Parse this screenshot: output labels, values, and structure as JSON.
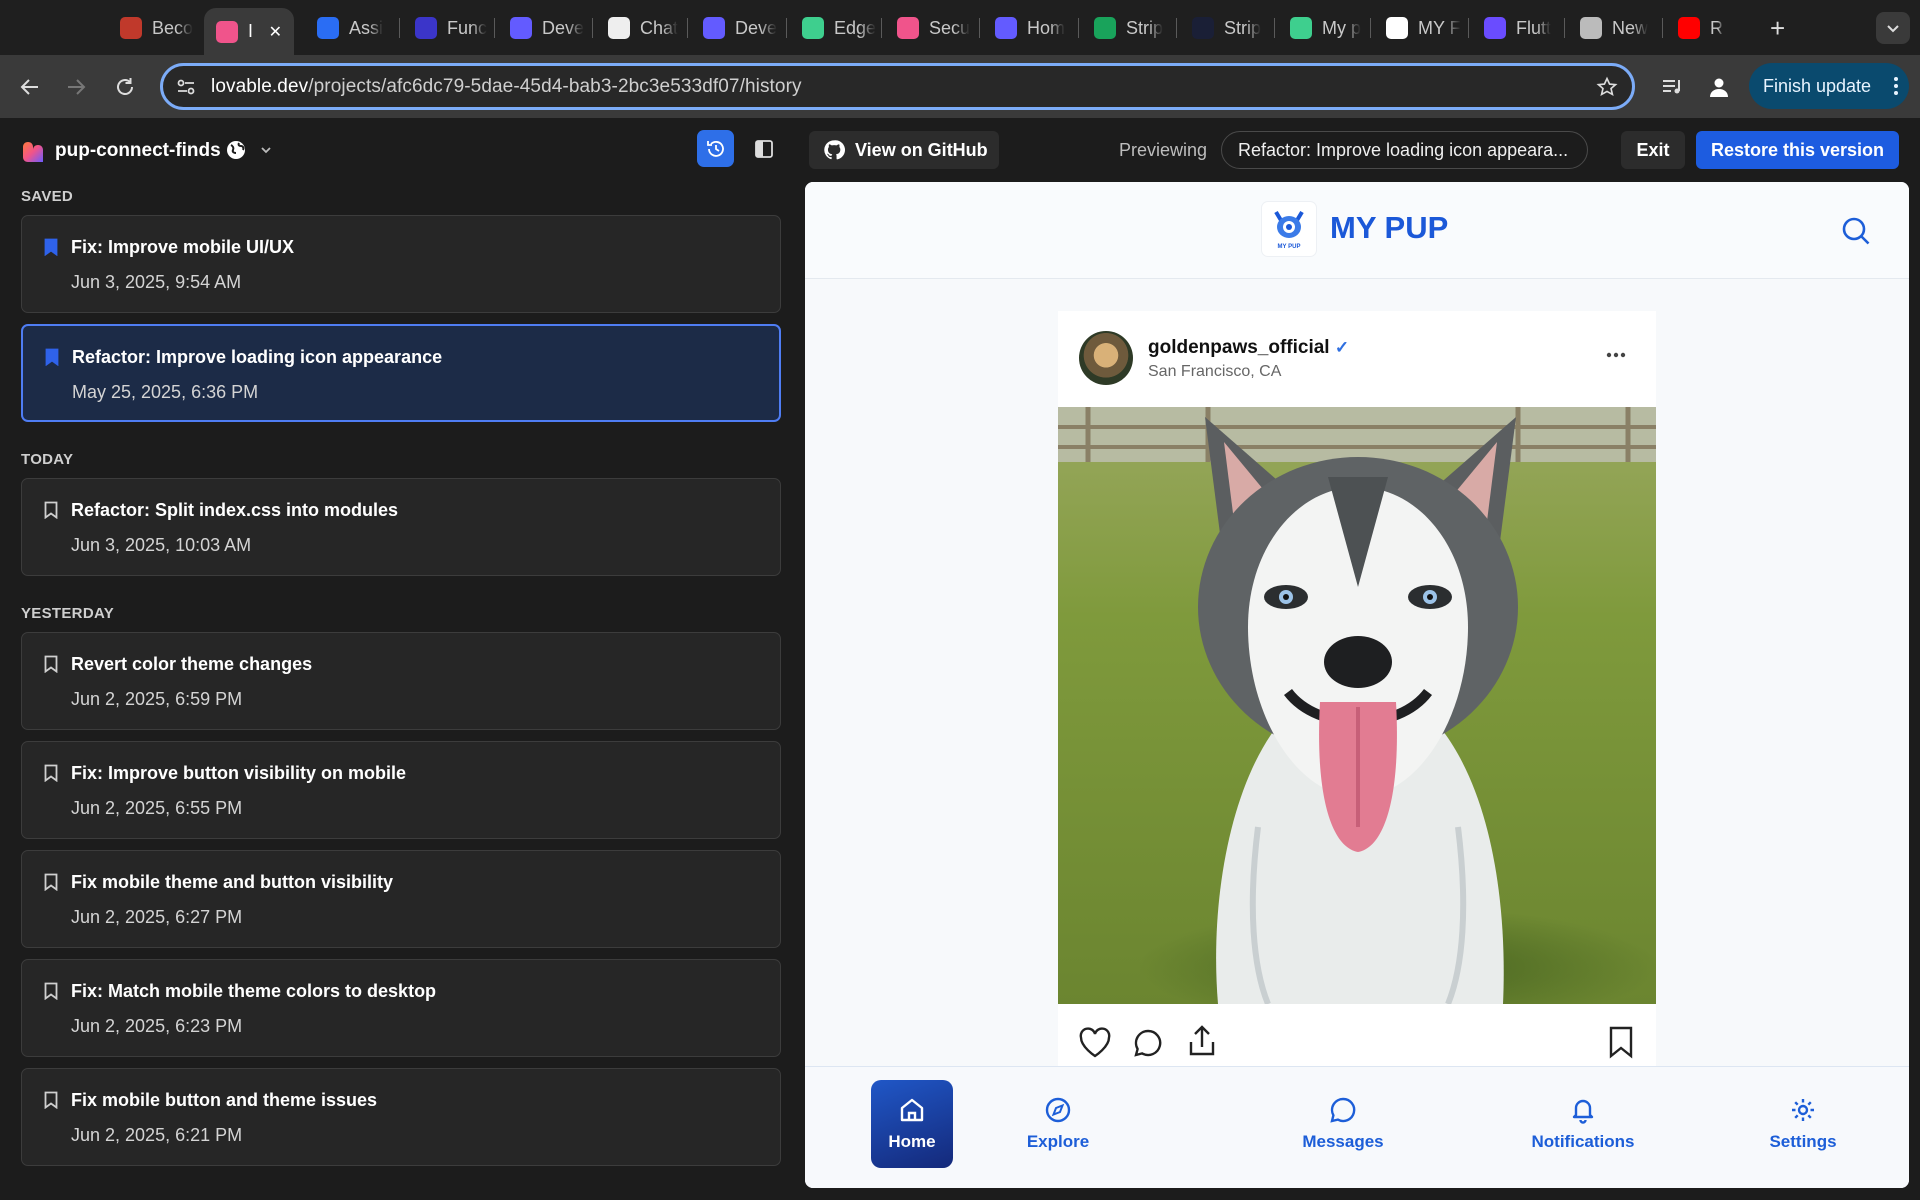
{
  "browser": {
    "tabs": [
      {
        "title": "Beco",
        "icon": "star-badge-icon",
        "color": "#c0392b"
      },
      {
        "title": "I",
        "icon": "lovable-icon",
        "color": "#f0548b",
        "active": true
      },
      {
        "title": "Assi",
        "icon": "openai-blue-icon",
        "color": "#2a6df4"
      },
      {
        "title": "Func",
        "icon": "openai-indigo-icon",
        "color": "#3b35c9"
      },
      {
        "title": "Deve",
        "icon": "stripe-s-icon",
        "color": "#635bff"
      },
      {
        "title": "Chat",
        "icon": "openai-icon",
        "color": "#eeeeee"
      },
      {
        "title": "Deve",
        "icon": "stripe-s-icon",
        "color": "#635bff"
      },
      {
        "title": "Edge",
        "icon": "supabase-bolt-icon",
        "color": "#3ecf8e"
      },
      {
        "title": "Secu",
        "icon": "lovable-icon",
        "color": "#f0548b"
      },
      {
        "title": "Hom",
        "icon": "stripe-s-icon",
        "color": "#635bff"
      },
      {
        "title": "Strip",
        "icon": "stripe-green-icon",
        "color": "#19a35b"
      },
      {
        "title": "Strip",
        "icon": "stripe-dark-icon",
        "color": "#1a1f36"
      },
      {
        "title": "My p",
        "icon": "supabase-bolt-icon",
        "color": "#3ecf8e"
      },
      {
        "title": "MY F",
        "icon": "mypup-icon",
        "color": "#ffffff"
      },
      {
        "title": "Flutt",
        "icon": "flutterflow-icon",
        "color": "#6a4cff"
      },
      {
        "title": "New",
        "icon": "chrome-icon",
        "color": "#bbbbbb"
      },
      {
        "title": "R",
        "icon": "youtube-icon",
        "color": "#ff0000"
      }
    ],
    "url_domain": "lovable.dev",
    "url_path": "/projects/afc6dc79-5dae-45d4-bab3-2bc3e533df07/history",
    "finish_update_label": "Finish update"
  },
  "sidebar": {
    "project_name": "pup-connect-finds",
    "sections": {
      "saved": "SAVED",
      "today": "TODAY",
      "yesterday": "YESTERDAY"
    },
    "saved": [
      {
        "title": "Fix: Improve mobile UI/UX",
        "date": "Jun 3, 2025, 9:54 AM",
        "bookmarked": true
      },
      {
        "title": "Refactor: Improve loading icon appearance",
        "date": "May 25, 2025, 6:36 PM",
        "bookmarked": true,
        "selected": true
      }
    ],
    "today": [
      {
        "title": "Refactor: Split index.css into modules",
        "date": "Jun 3, 2025, 10:03 AM"
      }
    ],
    "yesterday": [
      {
        "title": "Revert color theme changes",
        "date": "Jun 2, 2025, 6:59 PM"
      },
      {
        "title": "Fix: Improve button visibility on mobile",
        "date": "Jun 2, 2025, 6:55 PM"
      },
      {
        "title": "Fix mobile theme and button visibility",
        "date": "Jun 2, 2025, 6:27 PM"
      },
      {
        "title": "Fix: Match mobile theme colors to desktop",
        "date": "Jun 2, 2025, 6:23 PM"
      },
      {
        "title": "Fix mobile button and theme issues",
        "date": "Jun 2, 2025, 6:21 PM"
      }
    ]
  },
  "header": {
    "github_label": "View on GitHub",
    "previewing_label": "Previewing",
    "previewing_version": "Refactor: Improve loading icon appeara...",
    "exit_label": "Exit",
    "restore_label": "Restore this version"
  },
  "preview_app": {
    "brand": "MY PUP",
    "logo_text": "MY PUP",
    "post": {
      "username": "goldenpaws_official",
      "verified_mark": "✓",
      "location": "San Francisco, CA"
    },
    "nav": {
      "home": "Home",
      "explore": "Explore",
      "messages": "Messages",
      "notifications": "Notifications",
      "settings": "Settings"
    }
  },
  "colors": {
    "accent": "#1d5ce0",
    "selected_card": "#1c2b47",
    "brand_blue": "#1b58d8"
  }
}
